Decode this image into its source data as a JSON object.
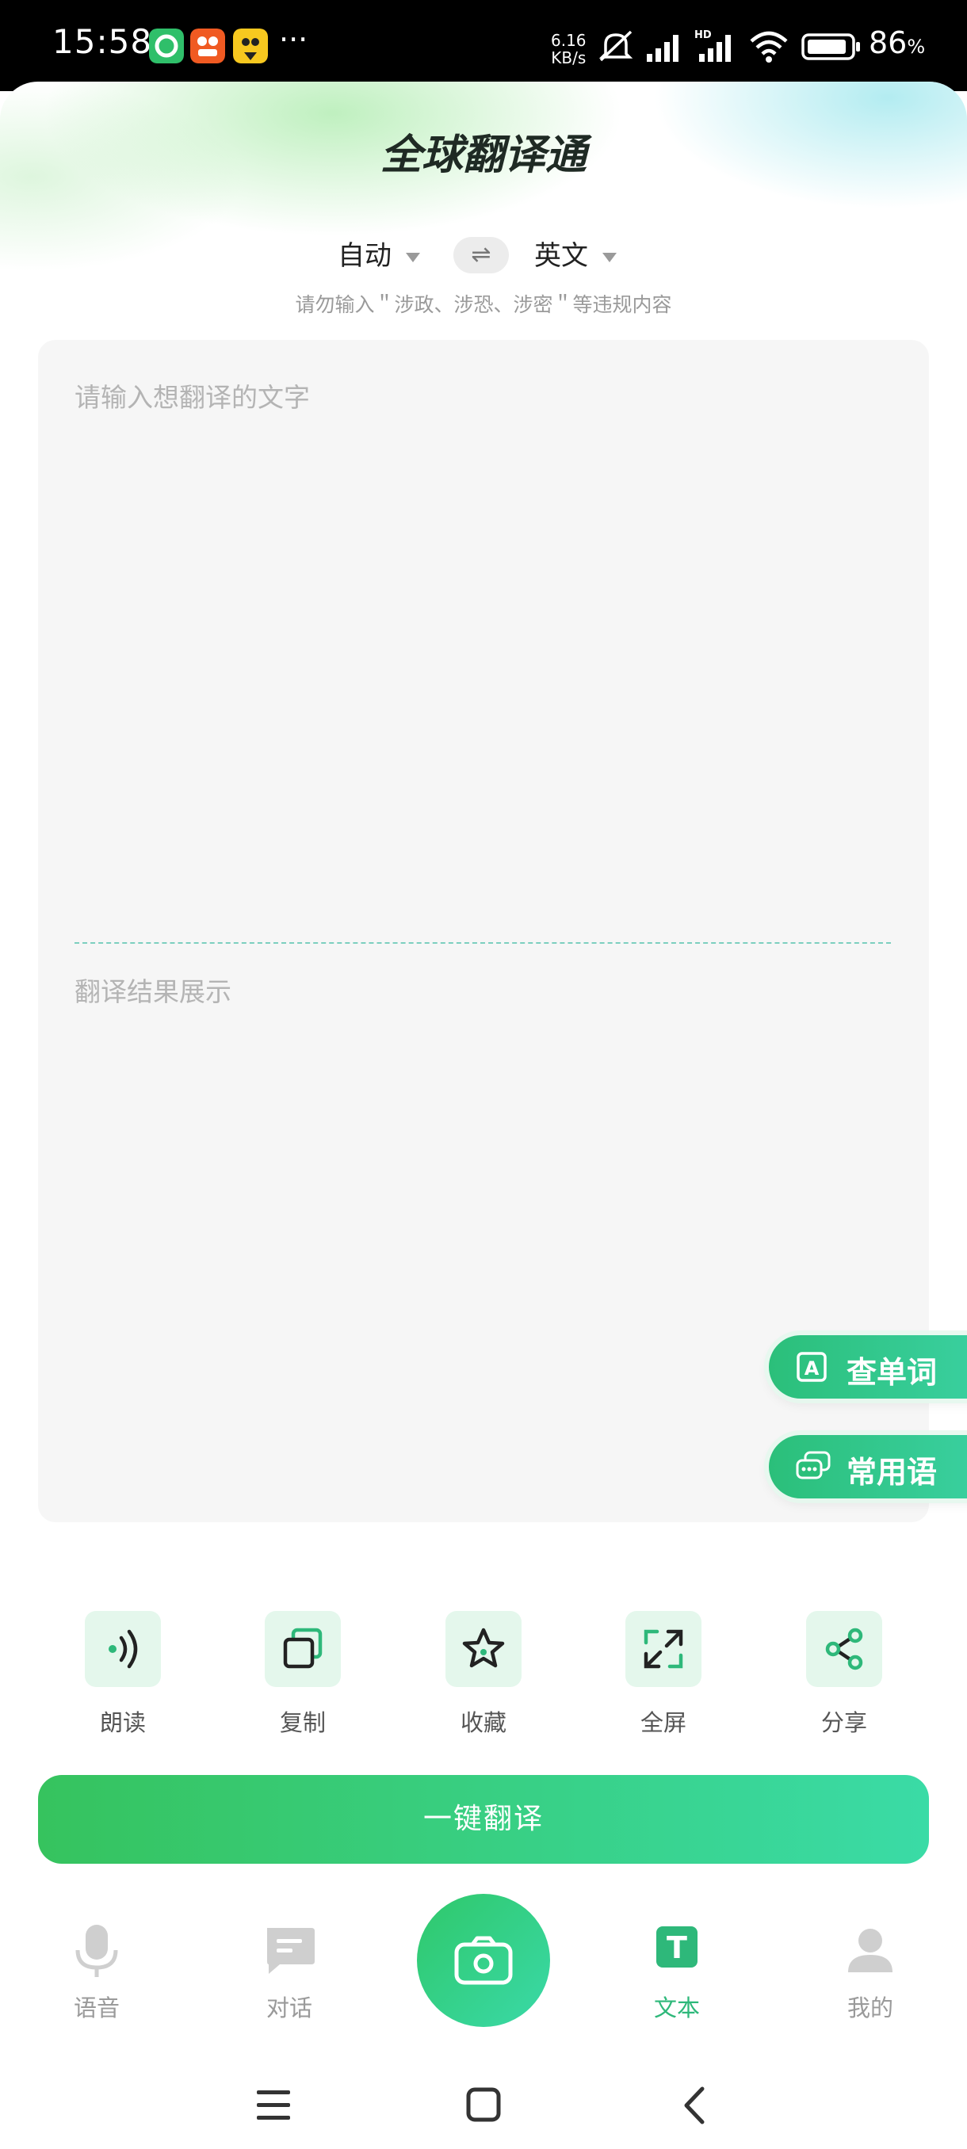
{
  "status_bar": {
    "time": "15:58",
    "more": "···",
    "net_speed_value": "6.16",
    "net_speed_unit": "KB/s",
    "battery": "86",
    "battery_unit": "%"
  },
  "header": {
    "title": "全球翻译通",
    "source_lang": "自动",
    "target_lang": "英文",
    "swap_symbol": "⇌",
    "notice": "请勿输入＂涉政、涉恐、涉密＂等违规内容"
  },
  "editor": {
    "input_placeholder": "请输入想翻译的文字",
    "result_placeholder": "翻译结果展示"
  },
  "side_buttons": {
    "lookup_word": "查单词",
    "common_phrases": "常用语"
  },
  "tools": {
    "read": "朗读",
    "copy": "复制",
    "favorite": "收藏",
    "fullscreen": "全屏",
    "share": "分享"
  },
  "translate_button": "一键翻译",
  "nav": {
    "voice": "语音",
    "dialog": "对话",
    "text": "文本",
    "mine": "我的"
  },
  "colors": {
    "accent": "#2eb87a",
    "button_start": "#36c35e",
    "button_end": "#3adba6"
  }
}
